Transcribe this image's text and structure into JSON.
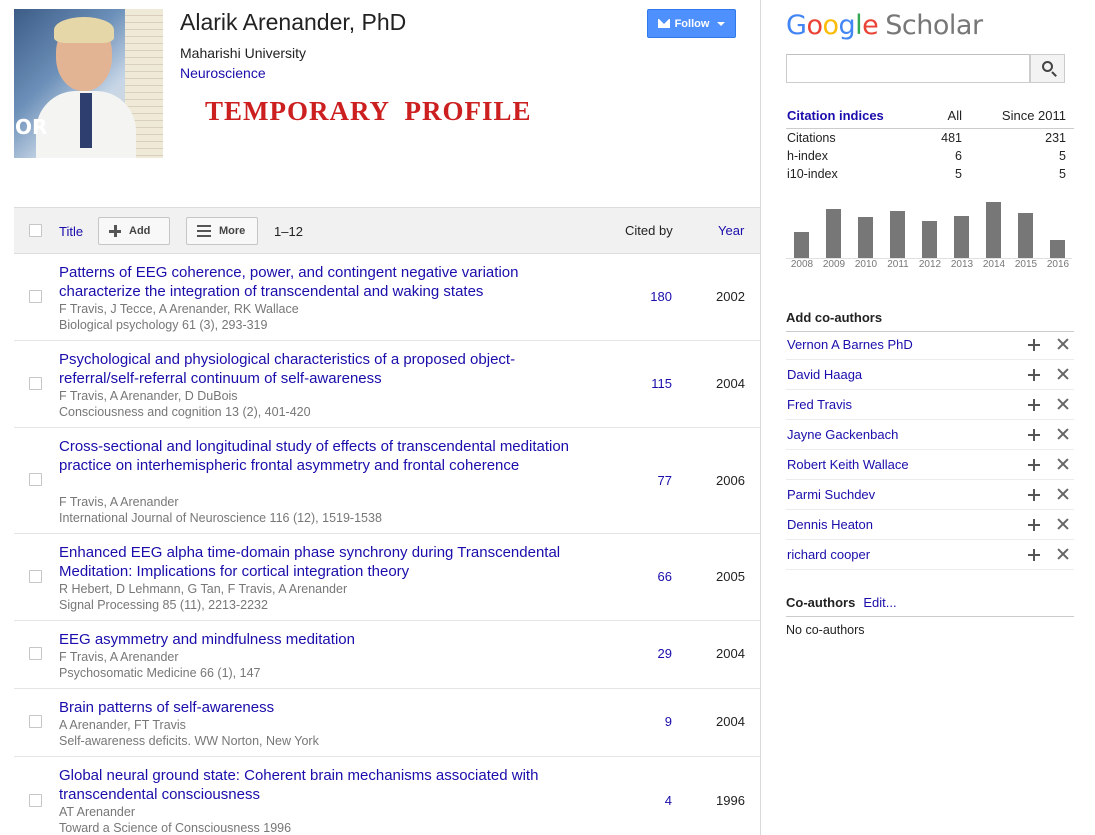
{
  "profile": {
    "name": "Alarik Arenander, PhD",
    "affiliation": "Maharishi University",
    "interest": "Neuroscience",
    "banner": "TEMPORARY  PROFILE",
    "photo_text": "OR",
    "follow_label": "Follow"
  },
  "table": {
    "title_label": "Title",
    "add_label": "Add",
    "more_label": "More",
    "range": "1–12",
    "cited_by_label": "Cited by",
    "year_label": "Year"
  },
  "articles": [
    {
      "title": "Patterns of EEG coherence, power, and contingent negative variation characterize the integration of transcendental and waking states",
      "authors": "F Travis, J Tecce, A Arenander, RK Wallace",
      "venue": "Biological psychology 61 (3), 293-319",
      "cited": "180",
      "year": "2002"
    },
    {
      "title": "Psychological and physiological characteristics of a proposed object-referral/self-referral continuum of self-awareness",
      "authors": "F Travis, A Arenander, D DuBois",
      "venue": "Consciousness and cognition 13 (2), 401-420",
      "cited": "115",
      "year": "2004"
    },
    {
      "title": "Cross-sectional and longitudinal study of effects of transcendental meditation practice on interhemispheric frontal asymmetry and frontal coherence",
      "authors": "F Travis, A Arenander",
      "venue": "International Journal of Neuroscience 116 (12), 1519-1538",
      "cited": "77",
      "year": "2006"
    },
    {
      "title": "Enhanced EEG alpha time-domain phase synchrony during Transcendental Meditation: Implications for cortical integration theory",
      "authors": "R Hebert, D Lehmann, G Tan, F Travis, A Arenander",
      "venue": "Signal Processing 85 (11), 2213-2232",
      "cited": "66",
      "year": "2005"
    },
    {
      "title": "EEG asymmetry and mindfulness meditation",
      "authors": "F Travis, A Arenander",
      "venue": "Psychosomatic Medicine 66 (1), 147",
      "cited": "29",
      "year": "2004"
    },
    {
      "title": "Brain patterns of self-awareness",
      "authors": "A Arenander, FT Travis",
      "venue": "Self-awareness deficits. WW Norton, New York",
      "cited": "9",
      "year": "2004"
    },
    {
      "title": "Global neural ground state: Coherent brain mechanisms associated with transcendental consciousness",
      "authors": "AT Arenander",
      "venue": "Toward a Science of Consciousness 1996",
      "cited": "4",
      "year": "1996"
    }
  ],
  "sidebar": {
    "logo_google": "Google",
    "logo_scholar": "Scholar",
    "citation_indices": {
      "label": "Citation indices",
      "col_all": "All",
      "col_since": "Since 2011",
      "rows": [
        {
          "name": "Citations",
          "all": "481",
          "since": "231"
        },
        {
          "name": "h-index",
          "all": "6",
          "since": "5"
        },
        {
          "name": "i10-index",
          "all": "5",
          "since": "5"
        }
      ]
    },
    "add_coauthors_label": "Add co-authors",
    "suggested_coauthors": [
      "Vernon A Barnes PhD",
      "David Haaga",
      "Fred Travis",
      "Jayne Gackenbach",
      "Robert Keith Wallace",
      "Parmi Suchdev",
      "Dennis Heaton",
      "richard cooper"
    ],
    "coauthors_label": "Co-authors",
    "edit_label": "Edit...",
    "no_coauthors": "No co-authors"
  },
  "chart_data": {
    "type": "bar",
    "categories": [
      "2008",
      "2009",
      "2010",
      "2011",
      "2012",
      "2013",
      "2014",
      "2015",
      "2016"
    ],
    "values": [
      26,
      49,
      41,
      47,
      37,
      42,
      56,
      45,
      18
    ],
    "bar_color": "#777777"
  }
}
